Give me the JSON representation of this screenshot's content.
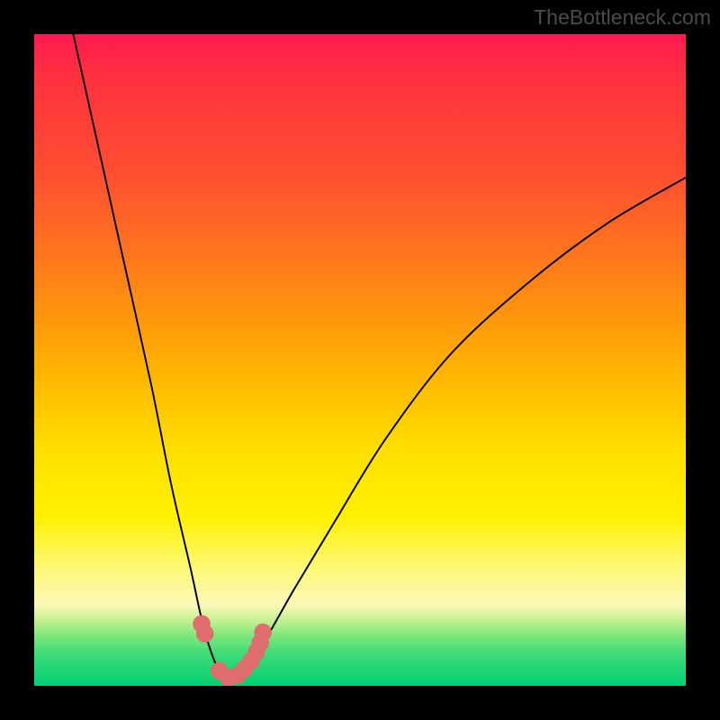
{
  "watermark": "TheBottleneck.com",
  "chart_data": {
    "type": "line",
    "title": "",
    "xlabel": "",
    "ylabel": "",
    "xlim": [
      0,
      100
    ],
    "ylim": [
      0,
      100
    ],
    "note": "Axes are unlabeled percentage scales; x is approximate horizontal position, y is bottleneck percentage (0 bottom, 100 top). Curve is a V-shape with minimum near x≈30.",
    "series": [
      {
        "name": "bottleneck-curve",
        "x": [
          6,
          10,
          14,
          18,
          21,
          24,
          26,
          28,
          29.5,
          31,
          33,
          36,
          40,
          46,
          54,
          64,
          76,
          88,
          100
        ],
        "y": [
          100,
          82,
          64,
          46,
          31,
          18,
          9,
          3,
          1,
          1.5,
          3.5,
          8,
          15,
          25,
          38,
          51,
          62,
          71,
          78
        ]
      }
    ],
    "markers": {
      "name": "highlighted-points",
      "x": [
        25.7,
        26.2,
        28.4,
        29.8,
        31.2,
        32.3,
        33.3,
        34.1,
        34.7,
        35.1
      ],
      "y": [
        9.5,
        8.0,
        2.3,
        1.2,
        1.6,
        2.6,
        3.8,
        5.2,
        6.6,
        8.2
      ]
    },
    "gradient_bands": {
      "description": "vertical color gradient representing quality (red=bad top, green=good bottom)",
      "stops": [
        {
          "pos": 0,
          "color": "#ff1a52"
        },
        {
          "pos": 0.22,
          "color": "#ff5030"
        },
        {
          "pos": 0.52,
          "color": "#ffb400"
        },
        {
          "pos": 0.74,
          "color": "#fff000"
        },
        {
          "pos": 0.88,
          "color": "#fcf8b8"
        },
        {
          "pos": 1.0,
          "color": "#00d074"
        }
      ]
    }
  }
}
